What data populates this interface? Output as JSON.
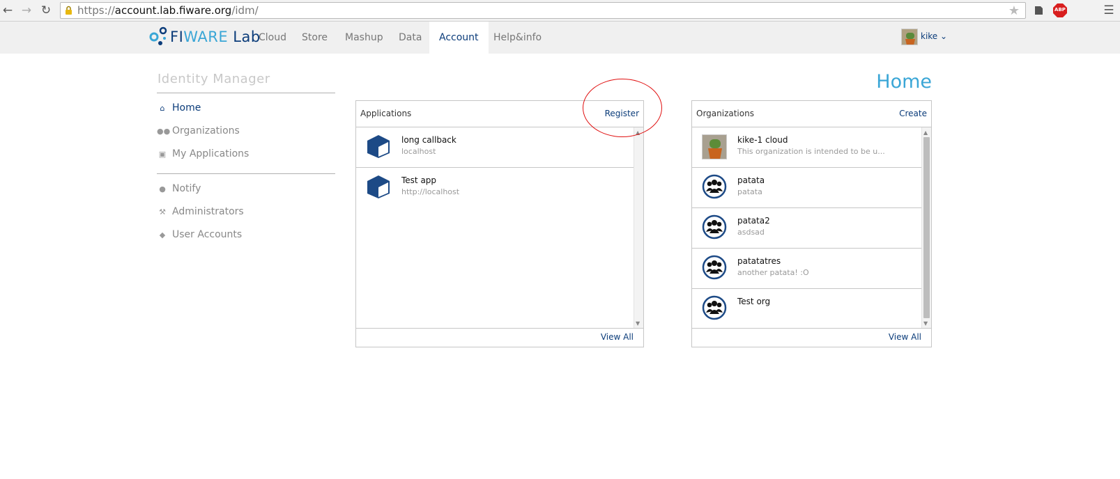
{
  "browser": {
    "url_prefix": "https://",
    "url_host": "account.lab.fiware.org",
    "url_path": "/idm/",
    "ext_abp": "ABP"
  },
  "navbar": {
    "logo_fi": "FI",
    "logo_ware": "WARE",
    "logo_lab": " Lab",
    "items": [
      {
        "label": "Cloud"
      },
      {
        "label": "Store"
      },
      {
        "label": "Mashup"
      },
      {
        "label": "Data"
      },
      {
        "label": "Account"
      },
      {
        "label": "Help&info"
      }
    ],
    "active": "Account",
    "user": "kike ",
    "user_caret": "⌄"
  },
  "sidebar": {
    "title": "Identity Manager",
    "items": [
      {
        "label": "Home",
        "icon": "home-icon"
      },
      {
        "label": "Organizations",
        "icon": "users-icon"
      },
      {
        "label": "My Applications",
        "icon": "cube-icon"
      },
      {
        "label": "Notify",
        "icon": "comment-icon"
      },
      {
        "label": "Administrators",
        "icon": "wrench-icon"
      },
      {
        "label": "User Accounts",
        "icon": "shield-icon"
      }
    ]
  },
  "main": {
    "title": "Home",
    "applications": {
      "title": "Applications",
      "action": "Register",
      "view_all": "View All",
      "items": [
        {
          "name": "long callback",
          "url": "localhost"
        },
        {
          "name": "Test app",
          "url": "http://localhost"
        }
      ]
    },
    "organizations": {
      "title": "Organizations",
      "action": "Create",
      "view_all": "View All",
      "items": [
        {
          "name": "kike-1 cloud",
          "description": "This organization is intended to be u..."
        },
        {
          "name": "patata",
          "description": "patata"
        },
        {
          "name": "patata2",
          "description": "asdsad"
        },
        {
          "name": "patatatres",
          "description": "another patata! :O"
        },
        {
          "name": "Test org",
          "description": ""
        }
      ]
    }
  },
  "colors": {
    "brand_dark": "#0b3c7a",
    "brand_light": "#3aa6d6",
    "annotation": "#e01010"
  }
}
